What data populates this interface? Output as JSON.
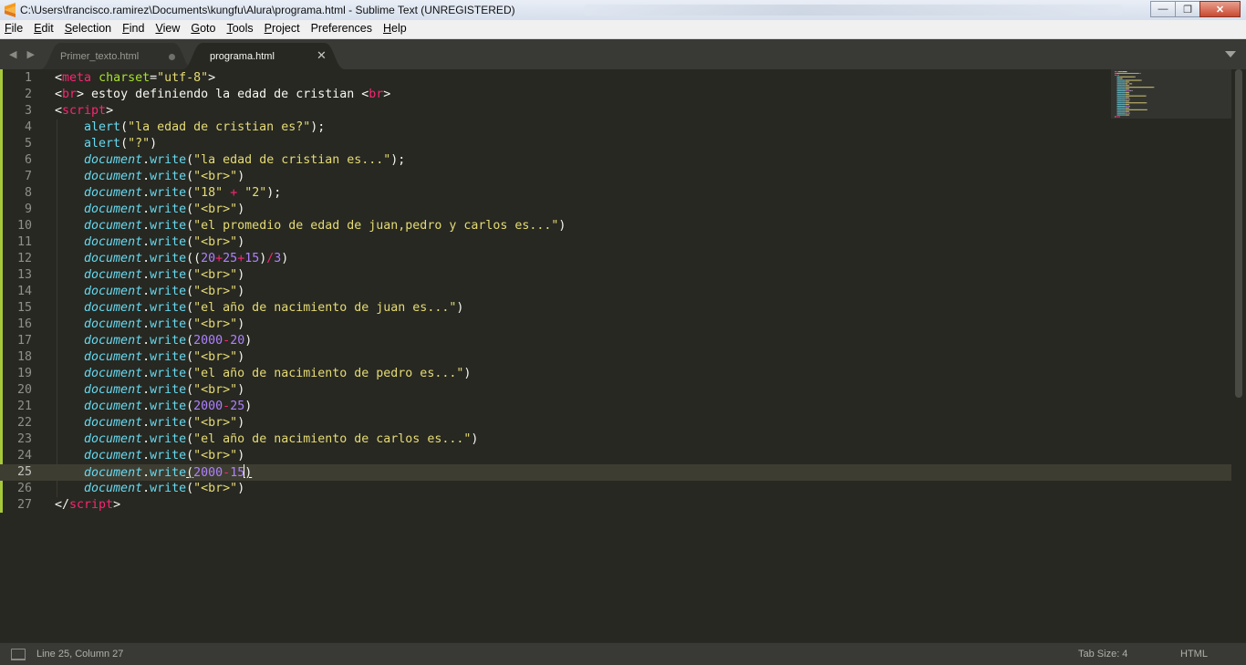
{
  "window": {
    "title": "C:\\Users\\francisco.ramirez\\Documents\\kungfu\\Alura\\programa.html - Sublime Text (UNREGISTERED)",
    "minimize_symbol": "—",
    "maximize_symbol": "❐",
    "close_symbol": "✕"
  },
  "menu": [
    {
      "mn": "F",
      "rest": "ile"
    },
    {
      "mn": "E",
      "rest": "dit"
    },
    {
      "mn": "S",
      "rest": "election"
    },
    {
      "mn": "F",
      "rest": "ind"
    },
    {
      "mn": "V",
      "rest": "iew"
    },
    {
      "mn": "G",
      "rest": "oto"
    },
    {
      "mn": "T",
      "rest": "ools"
    },
    {
      "mn": "P",
      "rest": "roject"
    },
    {
      "mn": "",
      "rest": "Preferences"
    },
    {
      "mn": "H",
      "rest": "elp"
    }
  ],
  "tabs": {
    "nav_arrows": "◀ ▶",
    "tab1": {
      "label": "Primer_texto.html"
    },
    "tab2": {
      "label": "programa.html",
      "close_symbol": "✕"
    }
  },
  "editor": {
    "current_line": 25,
    "line_numbers": [
      "1",
      "2",
      "3",
      "4",
      "5",
      "6",
      "7",
      "8",
      "9",
      "10",
      "11",
      "12",
      "13",
      "14",
      "15",
      "16",
      "17",
      "18",
      "19",
      "20",
      "21",
      "22",
      "23",
      "24",
      "25",
      "26",
      "27"
    ],
    "lines": [
      [
        [
          "p",
          "<"
        ],
        [
          "tg",
          "meta"
        ],
        [
          "p",
          " "
        ],
        [
          "at",
          "charset"
        ],
        [
          "p",
          "="
        ],
        [
          "st",
          "\"utf-8\""
        ],
        [
          "p",
          ">"
        ]
      ],
      [
        [
          "p",
          "<"
        ],
        [
          "tg",
          "br"
        ],
        [
          "p",
          "> estoy definiendo la edad de cristian <"
        ],
        [
          "tg",
          "br"
        ],
        [
          "p",
          ">"
        ]
      ],
      [
        [
          "p",
          "<"
        ],
        [
          "tg",
          "script"
        ],
        [
          "p",
          ">"
        ]
      ],
      [
        [
          "p",
          "    "
        ],
        [
          "fn",
          "alert"
        ],
        [
          "p",
          "("
        ],
        [
          "st",
          "\"la edad de cristian es?\""
        ],
        [
          "p",
          ");"
        ]
      ],
      [
        [
          "p",
          "    "
        ],
        [
          "fn",
          "alert"
        ],
        [
          "p",
          "("
        ],
        [
          "st",
          "\"?\""
        ],
        [
          "p",
          ")"
        ]
      ],
      [
        [
          "p",
          "    "
        ],
        [
          "ob",
          "document"
        ],
        [
          "p",
          "."
        ],
        [
          "fn",
          "write"
        ],
        [
          "p",
          "("
        ],
        [
          "st",
          "\"la edad de cristian es...\""
        ],
        [
          "p",
          ");"
        ]
      ],
      [
        [
          "p",
          "    "
        ],
        [
          "ob",
          "document"
        ],
        [
          "p",
          "."
        ],
        [
          "fn",
          "write"
        ],
        [
          "p",
          "("
        ],
        [
          "st",
          "\"<br>\""
        ],
        [
          "p",
          ")"
        ]
      ],
      [
        [
          "p",
          "    "
        ],
        [
          "ob",
          "document"
        ],
        [
          "p",
          "."
        ],
        [
          "fn",
          "write"
        ],
        [
          "p",
          "("
        ],
        [
          "st",
          "\"18\""
        ],
        [
          "p",
          " "
        ],
        [
          "op",
          "+"
        ],
        [
          "p",
          " "
        ],
        [
          "st",
          "\"2\""
        ],
        [
          "p",
          ");"
        ]
      ],
      [
        [
          "p",
          "    "
        ],
        [
          "ob",
          "document"
        ],
        [
          "p",
          "."
        ],
        [
          "fn",
          "write"
        ],
        [
          "p",
          "("
        ],
        [
          "st",
          "\"<br>\""
        ],
        [
          "p",
          ")"
        ]
      ],
      [
        [
          "p",
          "    "
        ],
        [
          "ob",
          "document"
        ],
        [
          "p",
          "."
        ],
        [
          "fn",
          "write"
        ],
        [
          "p",
          "("
        ],
        [
          "st",
          "\"el promedio de edad de juan,pedro y carlos es...\""
        ],
        [
          "p",
          ")"
        ]
      ],
      [
        [
          "p",
          "    "
        ],
        [
          "ob",
          "document"
        ],
        [
          "p",
          "."
        ],
        [
          "fn",
          "write"
        ],
        [
          "p",
          "("
        ],
        [
          "st",
          "\"<br>\""
        ],
        [
          "p",
          ")"
        ]
      ],
      [
        [
          "p",
          "    "
        ],
        [
          "ob",
          "document"
        ],
        [
          "p",
          "."
        ],
        [
          "fn",
          "write"
        ],
        [
          "p",
          "(("
        ],
        [
          "nm",
          "20"
        ],
        [
          "op",
          "+"
        ],
        [
          "nm",
          "25"
        ],
        [
          "op",
          "+"
        ],
        [
          "nm",
          "15"
        ],
        [
          "p",
          ")"
        ],
        [
          "op",
          "/"
        ],
        [
          "nm",
          "3"
        ],
        [
          "p",
          ")"
        ]
      ],
      [
        [
          "p",
          "    "
        ],
        [
          "ob",
          "document"
        ],
        [
          "p",
          "."
        ],
        [
          "fn",
          "write"
        ],
        [
          "p",
          "("
        ],
        [
          "st",
          "\"<br>\""
        ],
        [
          "p",
          ")"
        ]
      ],
      [
        [
          "p",
          "    "
        ],
        [
          "ob",
          "document"
        ],
        [
          "p",
          "."
        ],
        [
          "fn",
          "write"
        ],
        [
          "p",
          "("
        ],
        [
          "st",
          "\"<br>\""
        ],
        [
          "p",
          ")"
        ]
      ],
      [
        [
          "p",
          "    "
        ],
        [
          "ob",
          "document"
        ],
        [
          "p",
          "."
        ],
        [
          "fn",
          "write"
        ],
        [
          "p",
          "("
        ],
        [
          "st",
          "\"el año de nacimiento de juan es...\""
        ],
        [
          "p",
          ")"
        ]
      ],
      [
        [
          "p",
          "    "
        ],
        [
          "ob",
          "document"
        ],
        [
          "p",
          "."
        ],
        [
          "fn",
          "write"
        ],
        [
          "p",
          "("
        ],
        [
          "st",
          "\"<br>\""
        ],
        [
          "p",
          ")"
        ]
      ],
      [
        [
          "p",
          "    "
        ],
        [
          "ob",
          "document"
        ],
        [
          "p",
          "."
        ],
        [
          "fn",
          "write"
        ],
        [
          "p",
          "("
        ],
        [
          "nm",
          "2000"
        ],
        [
          "op",
          "-"
        ],
        [
          "nm",
          "20"
        ],
        [
          "p",
          ")"
        ]
      ],
      [
        [
          "p",
          "    "
        ],
        [
          "ob",
          "document"
        ],
        [
          "p",
          "."
        ],
        [
          "fn",
          "write"
        ],
        [
          "p",
          "("
        ],
        [
          "st",
          "\"<br>\""
        ],
        [
          "p",
          ")"
        ]
      ],
      [
        [
          "p",
          "    "
        ],
        [
          "ob",
          "document"
        ],
        [
          "p",
          "."
        ],
        [
          "fn",
          "write"
        ],
        [
          "p",
          "("
        ],
        [
          "st",
          "\"el año de nacimiento de pedro es...\""
        ],
        [
          "p",
          ")"
        ]
      ],
      [
        [
          "p",
          "    "
        ],
        [
          "ob",
          "document"
        ],
        [
          "p",
          "."
        ],
        [
          "fn",
          "write"
        ],
        [
          "p",
          "("
        ],
        [
          "st",
          "\"<br>\""
        ],
        [
          "p",
          ")"
        ]
      ],
      [
        [
          "p",
          "    "
        ],
        [
          "ob",
          "document"
        ],
        [
          "p",
          "."
        ],
        [
          "fn",
          "write"
        ],
        [
          "p",
          "("
        ],
        [
          "nm",
          "2000"
        ],
        [
          "op",
          "-"
        ],
        [
          "nm",
          "25"
        ],
        [
          "p",
          ")"
        ]
      ],
      [
        [
          "p",
          "    "
        ],
        [
          "ob",
          "document"
        ],
        [
          "p",
          "."
        ],
        [
          "fn",
          "write"
        ],
        [
          "p",
          "("
        ],
        [
          "st",
          "\"<br>\""
        ],
        [
          "p",
          ")"
        ]
      ],
      [
        [
          "p",
          "    "
        ],
        [
          "ob",
          "document"
        ],
        [
          "p",
          "."
        ],
        [
          "fn",
          "write"
        ],
        [
          "p",
          "("
        ],
        [
          "st",
          "\"el año de nacimiento de carlos es...\""
        ],
        [
          "p",
          ")"
        ]
      ],
      [
        [
          "p",
          "    "
        ],
        [
          "ob",
          "document"
        ],
        [
          "p",
          "."
        ],
        [
          "fn",
          "write"
        ],
        [
          "p",
          "("
        ],
        [
          "st",
          "\"<br>\""
        ],
        [
          "p",
          ")"
        ]
      ],
      [
        [
          "p",
          "    "
        ],
        [
          "ob",
          "document"
        ],
        [
          "p",
          "."
        ],
        [
          "fn",
          "write"
        ],
        [
          "bu",
          "("
        ],
        [
          "nm",
          "2000"
        ],
        [
          "op",
          "-"
        ],
        [
          "nm",
          "15"
        ],
        [
          "cur",
          ""
        ],
        [
          "bu",
          ")"
        ]
      ],
      [
        [
          "p",
          "    "
        ],
        [
          "ob",
          "document"
        ],
        [
          "p",
          "."
        ],
        [
          "fn",
          "write"
        ],
        [
          "p",
          "("
        ],
        [
          "st",
          "\"<br>\""
        ],
        [
          "p",
          ")"
        ]
      ],
      [
        [
          "p",
          "</"
        ],
        [
          "tg",
          "script"
        ],
        [
          "p",
          ">"
        ]
      ]
    ]
  },
  "status": {
    "position": "Line 25, Column 27",
    "tab_size": "Tab Size: 4",
    "syntax": "HTML"
  },
  "colors": {
    "background": "#272822",
    "tag": "#f92672",
    "attribute": "#a6e22e",
    "string": "#e6db74",
    "number": "#ae81ff",
    "function": "#66d9ef",
    "text": "#f8f8f2",
    "diff_gutter": "#a6c93a"
  }
}
